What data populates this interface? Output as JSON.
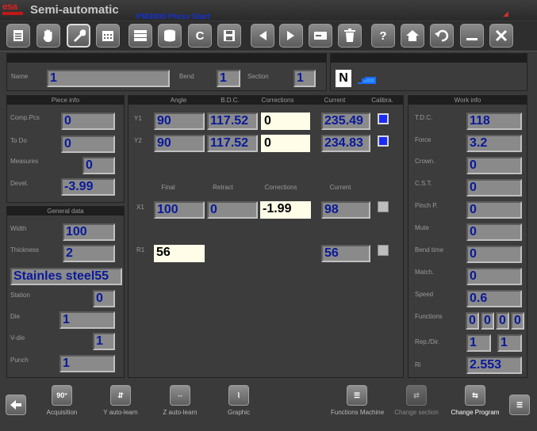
{
  "titlebar": {
    "mode": "Semi-automatic",
    "machine": "PM3000 Press Start",
    "logo": "esa"
  },
  "toolbar": {
    "buttons": [
      "document-icon",
      "hand-icon",
      "wrench-icon",
      "calendar-icon",
      "database-icon",
      "stack-icon",
      "c-icon",
      "floppy-icon",
      "left-arrow-icon",
      "right-arrow-icon",
      "card-icon",
      "trash-icon",
      "help-icon",
      "home-icon",
      "undo-icon",
      "minimize-icon",
      "close-icon"
    ],
    "c_label": "C",
    "help_label": "?"
  },
  "header": {
    "name_label": "Name",
    "name_value": "1",
    "bend_label": "Bend",
    "bend_value": "1",
    "section_label": "Section",
    "section_value": "1",
    "n_badge": "N"
  },
  "piece_info": {
    "title": "Piece info",
    "comp_pcs_label": "Comp.Pcs",
    "comp_pcs": "0",
    "to_do_label": "To Do",
    "to_do": "0",
    "measures_label": "Measures",
    "measures": "0",
    "devel_label": "Devel.",
    "devel": "-3.99"
  },
  "general_data": {
    "title": "General data",
    "width_label": "Width",
    "width": "100",
    "thickness_label": "Thickness",
    "thickness": "2",
    "material": "Stainles steel55",
    "station_label": "Station",
    "station": "0",
    "die_label": "Die",
    "die": "1",
    "vdie_label": "V-die",
    "vdie": "1",
    "punch_label": "Punch",
    "punch": "1"
  },
  "axes_y": {
    "headers": [
      "Angle",
      "B.D.C.",
      "Corrections",
      "Current",
      "Calibra."
    ],
    "y1_label": "Y1",
    "y1": {
      "angle": "90",
      "bdc": "117.52",
      "corrections": "0",
      "current": "235.49",
      "calibra": true
    },
    "y2_label": "Y2",
    "y2": {
      "angle": "90",
      "bdc": "117.52",
      "corrections": "0",
      "current": "234.83",
      "calibra": true
    }
  },
  "axes_x": {
    "headers": [
      "Final",
      "Retract",
      "Corrections",
      "Current"
    ],
    "x1_label": "X1",
    "x1": {
      "final": "100",
      "retract": "0",
      "corrections": "-1.99",
      "current": "98",
      "check": false
    },
    "r1_label": "R1",
    "r1": {
      "final": "56",
      "current": "56",
      "check": false
    }
  },
  "work_info": {
    "title": "Work info",
    "tdc_label": "T.D.C.",
    "tdc": "118",
    "force_label": "Force",
    "force": "3.2",
    "crown_label": "Crown.",
    "crown": "0",
    "cst_label": "C.S.T.",
    "cst": "0",
    "pinch_label": "Pinch P.",
    "pinch": "0",
    "mute_label": "Mute",
    "mute": "0",
    "bendtime_label": "Bend time",
    "bendtime": "0",
    "match_label": "Match.",
    "match": "0",
    "speed_label": "Speed",
    "speed": "0.6",
    "functions_label": "Functions",
    "functions": [
      "0",
      "0",
      "0",
      "0"
    ],
    "repdir_label": "Rep./Dir.",
    "repdir": [
      "1",
      "1"
    ],
    "ri_label": "Ri",
    "ri": "2.553"
  },
  "bottom": {
    "back_icon": "back-arrow-icon",
    "acquisition": "Acquisition",
    "acq_icon_text": "90°",
    "y_autolearn": "Y auto-learn",
    "z_autolearn": "Z auto-learn",
    "graphic": "Graphic",
    "functions_machine": "Functions Machine",
    "change_section": "Change section",
    "change_program": "Change Program"
  },
  "colors": {
    "accent_blue": "#1a2bff",
    "field_text": "#0a1a9a",
    "editable_bg": "#fffde8",
    "logo_red": "#c01818"
  }
}
